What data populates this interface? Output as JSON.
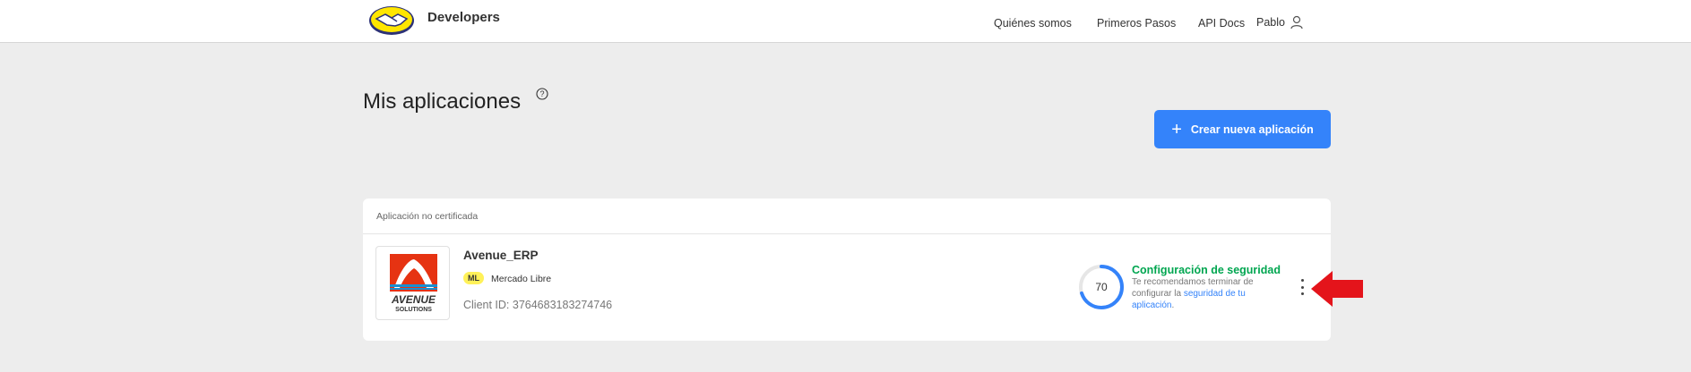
{
  "header": {
    "brand": "Developers",
    "nav": [
      "Quiénes somos",
      "Primeros Pasos",
      "API Docs"
    ],
    "user": "Pablo"
  },
  "page": {
    "title": "Mis aplicaciones",
    "create_button": "Crear nueva aplicación"
  },
  "card": {
    "status_label": "Aplicación no certificada",
    "app_name": "Avenue_ERP",
    "site_badge": "ML",
    "site_name": "Mercado Libre",
    "client_id": "Client ID: 3764683183274746",
    "logo_text_1": "AVENUE",
    "logo_text_2": "SOLUTIONS",
    "security": {
      "score": "70",
      "score_fraction": 0.7,
      "title": "Configuración de seguridad",
      "text_before": "Te recomendamos terminar de configurar la ",
      "link": "seguridad de tu aplicación",
      "text_after": "."
    }
  },
  "colors": {
    "accent": "#3483fa",
    "success": "#00a650",
    "badge": "#fff159",
    "annotation": "#e4141b"
  }
}
